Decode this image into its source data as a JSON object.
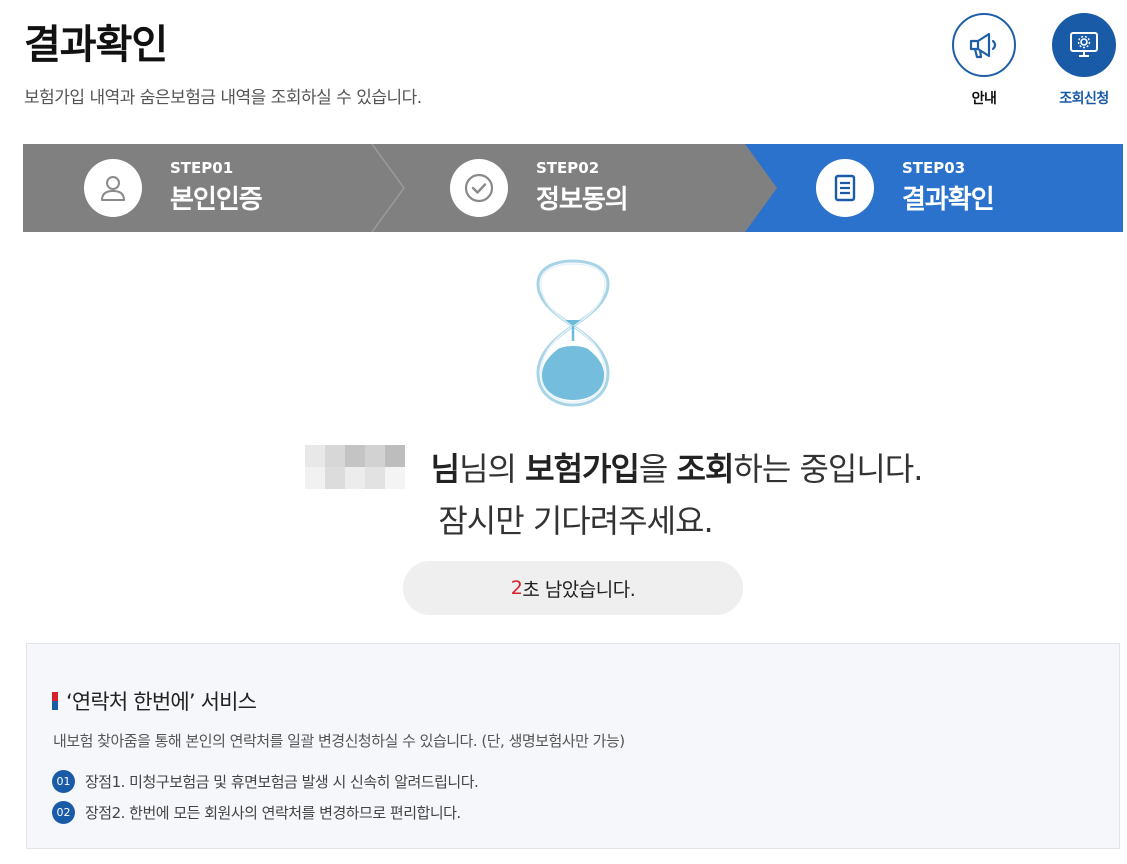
{
  "header": {
    "title": "결과확인",
    "description": "보험가입 내역과 숨은보험금 내역을 조회하실 수 있습니다."
  },
  "top_buttons": {
    "guide_label": "안내",
    "guide_icon": "megaphone-icon",
    "request_label": "조회신청",
    "request_icon": "monitor-gear-icon"
  },
  "steps": [
    {
      "num": "STEP01",
      "name": "본인인증",
      "icon": "user-icon",
      "active": false
    },
    {
      "num": "STEP02",
      "name": "정보동의",
      "icon": "check-circle-icon",
      "active": false
    },
    {
      "num": "STEP03",
      "name": "결과확인",
      "icon": "document-icon",
      "active": true
    }
  ],
  "status": {
    "part1": "님의 ",
    "part2": "보험가입",
    "part3": "을 ",
    "part4": "조회",
    "part5": "하는 중입니다.",
    "line2": "잠시만 기다려주세요."
  },
  "timer": {
    "seconds": "2",
    "suffix": "초 남았습니다."
  },
  "service": {
    "title": "‘연락처 한번에’ 서비스",
    "description": "내보험 찾아줌을 통해 본인의 연락처를 일괄 변경신청하실 수 있습니다. (단, 생명보험사만 가능)",
    "items": [
      {
        "badge": "01",
        "text": "장점1. 미청구보험금 및 휴면보험금 발생 시 신속히 알려드립니다."
      },
      {
        "badge": "02",
        "text": "장점2. 한번에 모든 회원사의 연락처를 변경하므로 편리합니다."
      }
    ]
  },
  "colors": {
    "primary": "#1a5ba8",
    "step_active": "#2a72cc",
    "step_inactive": "#808080",
    "timer_highlight": "#d8202a"
  }
}
